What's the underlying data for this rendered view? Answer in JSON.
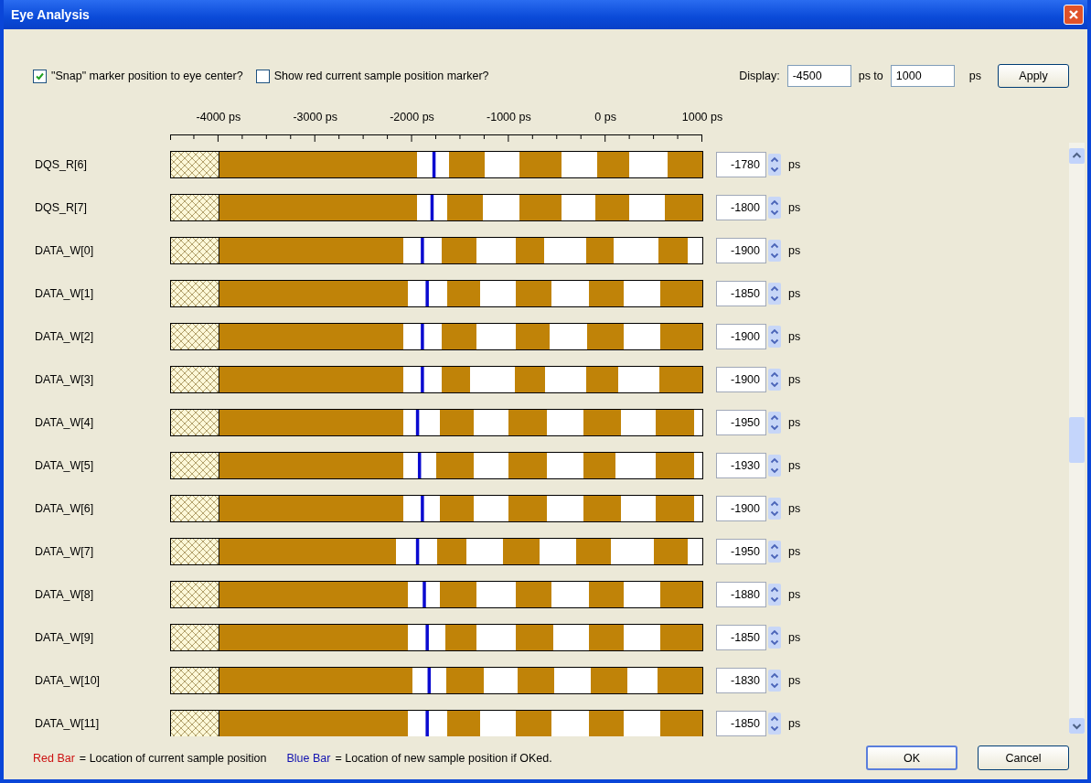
{
  "window": {
    "title": "Eye Analysis"
  },
  "options": [
    {
      "label": "\"Snap\" marker position to eye center?",
      "checked": true
    },
    {
      "label": "Show red current sample position marker?",
      "checked": false
    }
  ],
  "display": {
    "label": "Display:",
    "from": "-4500",
    "to_label": "ps to",
    "to": "1000",
    "unit": "ps",
    "apply": "Apply"
  },
  "eye_chart": {
    "chart_data": {
      "type": "bar",
      "orientation": "horizontal",
      "stacked": true,
      "xlim": [
        -4500,
        1000
      ],
      "xticks": [
        {
          "value": -4000,
          "label": "-4000 ps"
        },
        {
          "value": -3000,
          "label": "-3000 ps"
        },
        {
          "value": -2000,
          "label": "-2000 ps"
        },
        {
          "value": -1000,
          "label": "-1000 ps"
        },
        {
          "value": 0,
          "label": "0 ps"
        },
        {
          "value": 1000,
          "label": "1000 ps"
        }
      ],
      "categories": [
        "DQS_R[6]",
        "DQS_R[7]",
        "DATA_W[0]",
        "DATA_W[1]",
        "DATA_W[2]",
        "DATA_W[3]",
        "DATA_W[4]",
        "DATA_W[5]",
        "DATA_W[6]",
        "DATA_W[7]",
        "DATA_W[8]",
        "DATA_W[9]",
        "DATA_W[10]",
        "DATA_W[11]"
      ],
      "series": [
        {
          "color": "#c08308",
          "values": [
            -100,
            -120,
            -210,
            -180,
            -200,
            -210,
            -240,
            -240,
            -240,
            -310,
            -180,
            -180,
            -160,
            -180
          ]
        },
        {
          "color": "#ffffff",
          "values": [
            -370,
            -350,
            -440,
            -390,
            -390,
            -430,
            -380,
            -380,
            -380,
            -380,
            -390,
            -370,
            -380,
            -390
          ]
        },
        {
          "color": "#c08308",
          "values": [
            -430,
            -430,
            -290,
            -370,
            -350,
            -310,
            -390,
            -390,
            -390,
            -380,
            -370,
            -390,
            -380,
            -370
          ]
        },
        {
          "color": "#ffffff",
          "values": [
            -360,
            -380,
            -400,
            -370,
            -400,
            -460,
            -360,
            -360,
            -360,
            -380,
            -400,
            -400,
            -350,
            -370
          ]
        },
        {
          "color": "#c08308",
          "values": [
            -370,
            -370,
            -360,
            -340,
            -360,
            -290,
            -350,
            -390,
            -350,
            -300,
            -380,
            -330,
            -390,
            -340
          ]
        },
        {
          "color": "#ffffff",
          "values": [
            -330,
            -310,
            -400,
            -400,
            -400,
            -400,
            -380,
            -340,
            -380,
            -430,
            -330,
            -380,
            -350,
            -400
          ]
        },
        {
          "color": "#c08308",
          "values": [
            -2040,
            -2040,
            -1900,
            -1950,
            -1900,
            -1900,
            -1900,
            -1900,
            -1900,
            -1820,
            -1950,
            -1950,
            -1990,
            -1950
          ]
        },
        {
          "color": "#fdf8d8",
          "values": [
            -500,
            -500,
            -500,
            -500,
            -500,
            -500,
            -500,
            -500,
            -500,
            -500,
            -500,
            -500,
            -500,
            -500
          ]
        },
        {
          "color": "#c08308",
          "values": [
            240,
            240,
            80,
            180,
            180,
            130,
            150,
            100,
            150,
            50,
            180,
            180,
            220,
            180
          ]
        },
        {
          "color": "#ffffff",
          "values": [
            400,
            370,
            460,
            380,
            380,
            420,
            360,
            410,
            360,
            440,
            380,
            380,
            310,
            380
          ]
        },
        {
          "color": "#c08308",
          "values": [
            360,
            390,
            300,
            440,
            440,
            450,
            400,
            400,
            400,
            350,
            440,
            440,
            470,
            440
          ]
        },
        {
          "color": "#ffffff",
          "values": [
            null,
            null,
            160,
            null,
            null,
            null,
            90,
            90,
            90,
            160,
            null,
            null,
            null,
            null
          ]
        }
      ]
    }
  },
  "positions": [
    {
      "value": "-1780",
      "unit": "ps"
    },
    {
      "value": "-1800",
      "unit": "ps"
    },
    {
      "value": "-1900",
      "unit": "ps"
    },
    {
      "value": "-1850",
      "unit": "ps"
    },
    {
      "value": "-1900",
      "unit": "ps"
    },
    {
      "value": "-1900",
      "unit": "ps"
    },
    {
      "value": "-1950",
      "unit": "ps"
    },
    {
      "value": "-1930",
      "unit": "ps"
    },
    {
      "value": "-1900",
      "unit": "ps"
    },
    {
      "value": "-1950",
      "unit": "ps"
    },
    {
      "value": "-1880",
      "unit": "ps"
    },
    {
      "value": "-1850",
      "unit": "ps"
    },
    {
      "value": "-1830",
      "unit": "ps"
    },
    {
      "value": "-1850",
      "unit": "ps"
    }
  ],
  "legend": [
    {
      "key": "Red Bar",
      "color": "#cc1010",
      "text": "= Location of current sample position"
    },
    {
      "key": "Blue Bar",
      "color": "#1010b0",
      "text": "= Location of new sample position if OKed."
    }
  ],
  "buttons": [
    {
      "label": "OK",
      "default": true
    },
    {
      "label": "Cancel",
      "default": false
    }
  ]
}
